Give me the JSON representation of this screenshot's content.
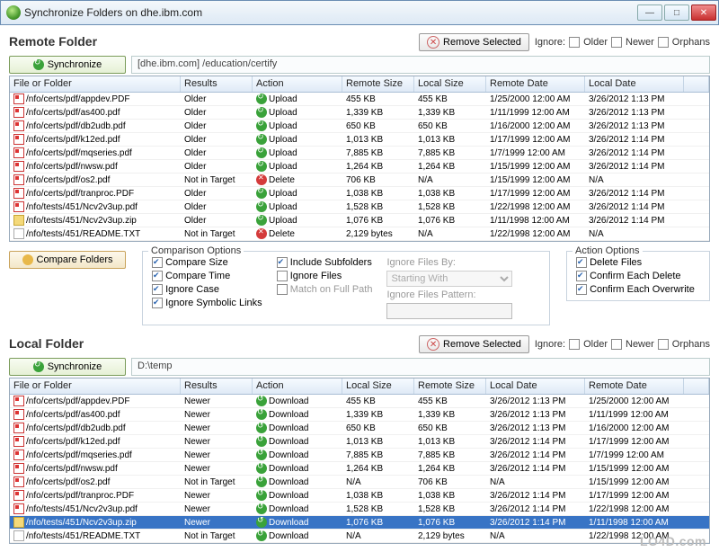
{
  "window": {
    "title": "Synchronize Folders on dhe.ibm.com"
  },
  "remote": {
    "heading": "Remote Folder",
    "remove_btn": "Remove Selected",
    "ignore_label": "Ignore:",
    "ignore_older": "Older",
    "ignore_newer": "Newer",
    "ignore_orphans": "Orphans",
    "sync_btn": "Synchronize",
    "path": "[dhe.ibm.com] /education/certify",
    "columns": [
      "File or Folder",
      "Results",
      "Action",
      "Remote Size",
      "Local Size",
      "Remote Date",
      "Local Date"
    ],
    "rows": [
      {
        "icon": "pdf",
        "file": "/nfo/certs/pdf/appdev.PDF",
        "result": "Older",
        "aicon": "up",
        "action": "Upload",
        "s1": "455 KB",
        "s2": "455 KB",
        "d1": "1/25/2000 12:00 AM",
        "d2": "3/26/2012 1:13 PM"
      },
      {
        "icon": "pdf",
        "file": "/nfo/certs/pdf/as400.pdf",
        "result": "Older",
        "aicon": "up",
        "action": "Upload",
        "s1": "1,339 KB",
        "s2": "1,339 KB",
        "d1": "1/11/1999 12:00 AM",
        "d2": "3/26/2012 1:13 PM"
      },
      {
        "icon": "pdf",
        "file": "/nfo/certs/pdf/db2udb.pdf",
        "result": "Older",
        "aicon": "up",
        "action": "Upload",
        "s1": "650 KB",
        "s2": "650 KB",
        "d1": "1/16/2000 12:00 AM",
        "d2": "3/26/2012 1:13 PM"
      },
      {
        "icon": "pdf",
        "file": "/nfo/certs/pdf/k12ed.pdf",
        "result": "Older",
        "aicon": "up",
        "action": "Upload",
        "s1": "1,013 KB",
        "s2": "1,013 KB",
        "d1": "1/17/1999 12:00 AM",
        "d2": "3/26/2012 1:14 PM"
      },
      {
        "icon": "pdf",
        "file": "/nfo/certs/pdf/mqseries.pdf",
        "result": "Older",
        "aicon": "up",
        "action": "Upload",
        "s1": "7,885 KB",
        "s2": "7,885 KB",
        "d1": "1/7/1999 12:00 AM",
        "d2": "3/26/2012 1:14 PM"
      },
      {
        "icon": "pdf",
        "file": "/nfo/certs/pdf/nwsw.pdf",
        "result": "Older",
        "aicon": "up",
        "action": "Upload",
        "s1": "1,264 KB",
        "s2": "1,264 KB",
        "d1": "1/15/1999 12:00 AM",
        "d2": "3/26/2012 1:14 PM"
      },
      {
        "icon": "pdf",
        "file": "/nfo/certs/pdf/os2.pdf",
        "result": "Not in Target",
        "aicon": "del",
        "action": "Delete",
        "s1": "706 KB",
        "s2": "N/A",
        "d1": "1/15/1999 12:00 AM",
        "d2": "N/A"
      },
      {
        "icon": "pdf",
        "file": "/nfo/certs/pdf/tranproc.PDF",
        "result": "Older",
        "aicon": "up",
        "action": "Upload",
        "s1": "1,038 KB",
        "s2": "1,038 KB",
        "d1": "1/17/1999 12:00 AM",
        "d2": "3/26/2012 1:14 PM"
      },
      {
        "icon": "pdf",
        "file": "/nfo/tests/451/Ncv2v3up.pdf",
        "result": "Older",
        "aicon": "up",
        "action": "Upload",
        "s1": "1,528 KB",
        "s2": "1,528 KB",
        "d1": "1/22/1998 12:00 AM",
        "d2": "3/26/2012 1:14 PM"
      },
      {
        "icon": "zip",
        "file": "/nfo/tests/451/Ncv2v3up.zip",
        "result": "Older",
        "aicon": "up",
        "action": "Upload",
        "s1": "1,076 KB",
        "s2": "1,076 KB",
        "d1": "1/11/1998 12:00 AM",
        "d2": "3/26/2012 1:14 PM"
      },
      {
        "icon": "txt",
        "file": "/nfo/tests/451/README.TXT",
        "result": "Not in Target",
        "aicon": "del",
        "action": "Delete",
        "s1": "2,129 bytes",
        "s2": "N/A",
        "d1": "1/22/1998 12:00 AM",
        "d2": "N/A"
      }
    ]
  },
  "middle": {
    "compare_btn": "Compare Folders",
    "comparison_legend": "Comparison Options",
    "opt_compare_size": "Compare Size",
    "opt_compare_time": "Compare Time",
    "opt_ignore_case": "Ignore Case",
    "opt_ignore_links": "Ignore Symbolic Links",
    "opt_include_sub": "Include Subfolders",
    "opt_ignore_files": "Ignore Files",
    "opt_match_path": "Match on Full Path",
    "ignore_by_label": "Ignore Files By:",
    "ignore_by_value": "Starting With",
    "ignore_pattern_label": "Ignore Files Pattern:",
    "action_legend": "Action Options",
    "opt_delete_files": "Delete Files",
    "opt_confirm_delete": "Confirm Each Delete",
    "opt_confirm_overwrite": "Confirm Each Overwrite"
  },
  "local": {
    "heading": "Local Folder",
    "remove_btn": "Remove Selected",
    "ignore_label": "Ignore:",
    "ignore_older": "Older",
    "ignore_newer": "Newer",
    "ignore_orphans": "Orphans",
    "sync_btn": "Synchronize",
    "path": "D:\\temp",
    "columns": [
      "File or Folder",
      "Results",
      "Action",
      "Local Size",
      "Remote Size",
      "Local Date",
      "Remote Date"
    ],
    "rows": [
      {
        "icon": "pdf",
        "file": "/nfo/certs/pdf/appdev.PDF",
        "result": "Newer",
        "aicon": "down",
        "action": "Download",
        "s1": "455 KB",
        "s2": "455 KB",
        "d1": "3/26/2012 1:13 PM",
        "d2": "1/25/2000 12:00 AM"
      },
      {
        "icon": "pdf",
        "file": "/nfo/certs/pdf/as400.pdf",
        "result": "Newer",
        "aicon": "down",
        "action": "Download",
        "s1": "1,339 KB",
        "s2": "1,339 KB",
        "d1": "3/26/2012 1:13 PM",
        "d2": "1/11/1999 12:00 AM"
      },
      {
        "icon": "pdf",
        "file": "/nfo/certs/pdf/db2udb.pdf",
        "result": "Newer",
        "aicon": "down",
        "action": "Download",
        "s1": "650 KB",
        "s2": "650 KB",
        "d1": "3/26/2012 1:13 PM",
        "d2": "1/16/2000 12:00 AM"
      },
      {
        "icon": "pdf",
        "file": "/nfo/certs/pdf/k12ed.pdf",
        "result": "Newer",
        "aicon": "down",
        "action": "Download",
        "s1": "1,013 KB",
        "s2": "1,013 KB",
        "d1": "3/26/2012 1:14 PM",
        "d2": "1/17/1999 12:00 AM"
      },
      {
        "icon": "pdf",
        "file": "/nfo/certs/pdf/mqseries.pdf",
        "result": "Newer",
        "aicon": "down",
        "action": "Download",
        "s1": "7,885 KB",
        "s2": "7,885 KB",
        "d1": "3/26/2012 1:14 PM",
        "d2": "1/7/1999 12:00 AM"
      },
      {
        "icon": "pdf",
        "file": "/nfo/certs/pdf/nwsw.pdf",
        "result": "Newer",
        "aicon": "down",
        "action": "Download",
        "s1": "1,264 KB",
        "s2": "1,264 KB",
        "d1": "3/26/2012 1:14 PM",
        "d2": "1/15/1999 12:00 AM"
      },
      {
        "icon": "pdf",
        "file": "/nfo/certs/pdf/os2.pdf",
        "result": "Not in Target",
        "aicon": "down",
        "action": "Download",
        "s1": "N/A",
        "s2": "706 KB",
        "d1": "N/A",
        "d2": "1/15/1999 12:00 AM"
      },
      {
        "icon": "pdf",
        "file": "/nfo/certs/pdf/tranproc.PDF",
        "result": "Newer",
        "aicon": "down",
        "action": "Download",
        "s1": "1,038 KB",
        "s2": "1,038 KB",
        "d1": "3/26/2012 1:14 PM",
        "d2": "1/17/1999 12:00 AM"
      },
      {
        "icon": "pdf",
        "file": "/nfo/tests/451/Ncv2v3up.pdf",
        "result": "Newer",
        "aicon": "down",
        "action": "Download",
        "s1": "1,528 KB",
        "s2": "1,528 KB",
        "d1": "3/26/2012 1:14 PM",
        "d2": "1/22/1998 12:00 AM"
      },
      {
        "icon": "zip",
        "file": "/nfo/tests/451/Ncv2v3up.zip",
        "result": "Newer",
        "aicon": "down",
        "action": "Download",
        "s1": "1,076 KB",
        "s2": "1,076 KB",
        "d1": "3/26/2012 1:14 PM",
        "d2": "1/11/1998 12:00 AM",
        "sel": true
      },
      {
        "icon": "txt",
        "file": "/nfo/tests/451/README.TXT",
        "result": "Not in Target",
        "aicon": "down",
        "action": "Download",
        "s1": "N/A",
        "s2": "2,129 bytes",
        "d1": "N/A",
        "d2": "1/22/1998 12:00 AM"
      }
    ]
  },
  "watermark": "LO4D.com"
}
